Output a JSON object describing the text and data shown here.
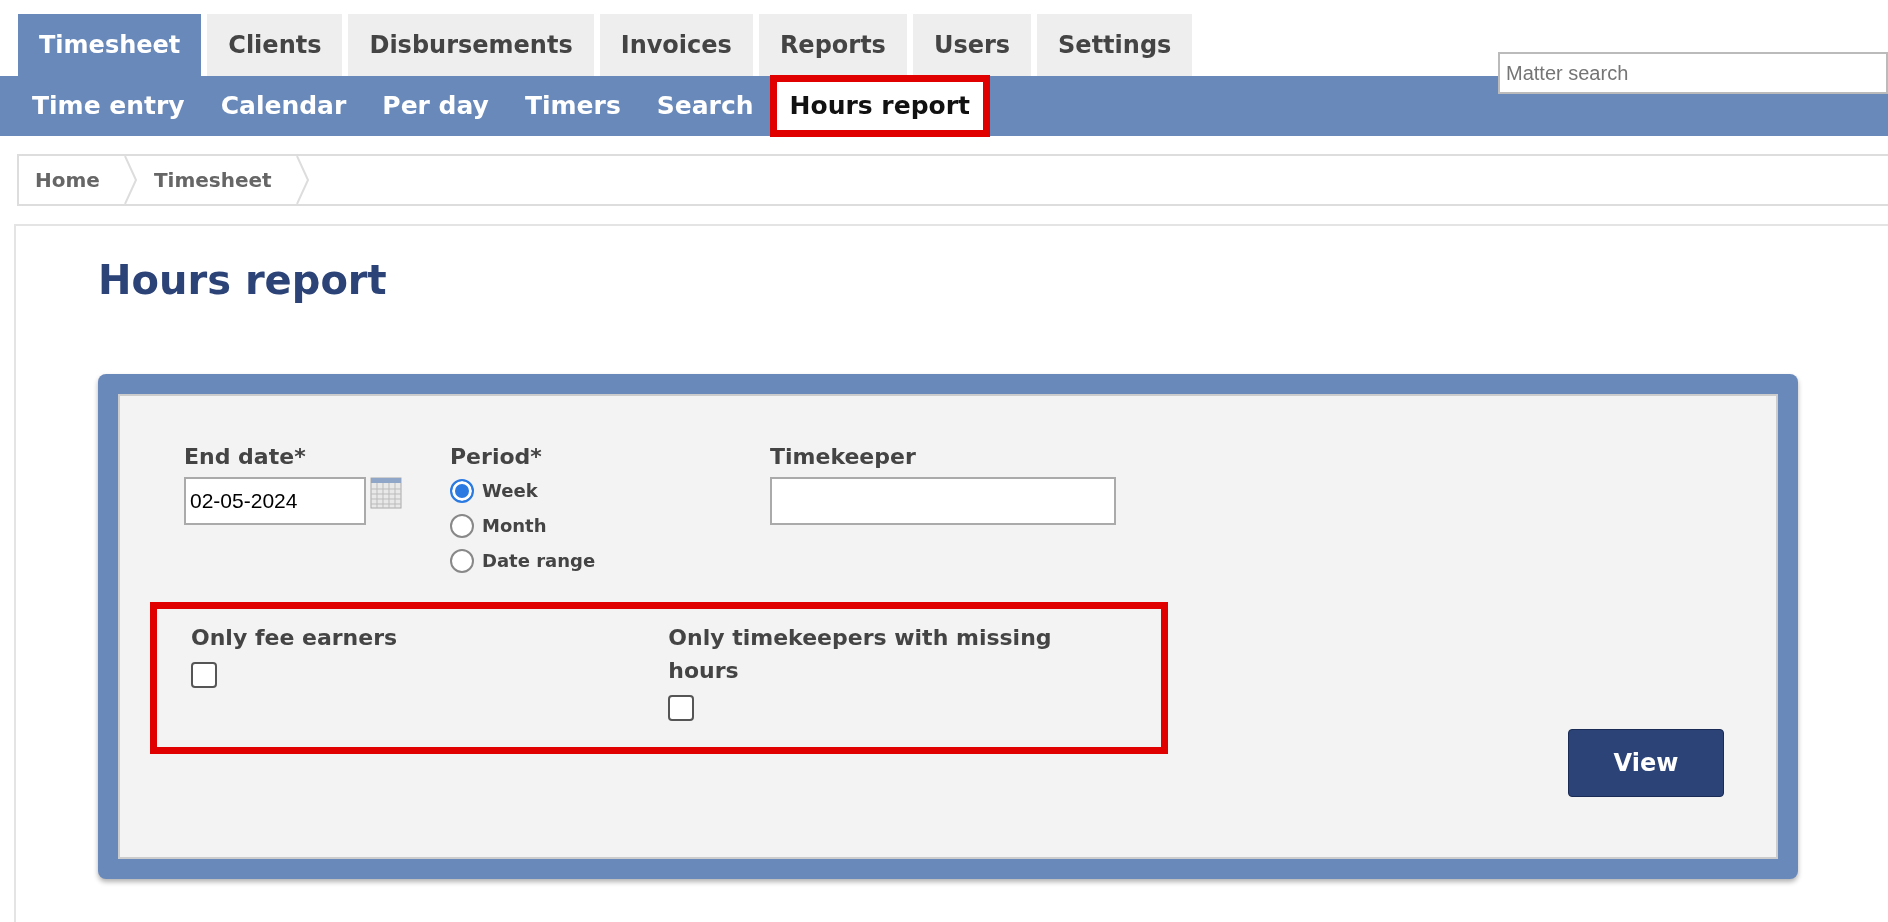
{
  "tabs": [
    {
      "label": "Timesheet",
      "selected": true
    },
    {
      "label": "Clients",
      "selected": false
    },
    {
      "label": "Disbursements",
      "selected": false
    },
    {
      "label": "Invoices",
      "selected": false
    },
    {
      "label": "Reports",
      "selected": false
    },
    {
      "label": "Users",
      "selected": false
    },
    {
      "label": "Settings",
      "selected": false
    }
  ],
  "search": {
    "placeholder": "Matter search"
  },
  "subtabs": [
    {
      "label": "Time entry",
      "selected": false,
      "highlighted": false
    },
    {
      "label": "Calendar",
      "selected": false,
      "highlighted": false
    },
    {
      "label": "Per day",
      "selected": false,
      "highlighted": false
    },
    {
      "label": "Timers",
      "selected": false,
      "highlighted": false
    },
    {
      "label": "Search",
      "selected": false,
      "highlighted": false
    },
    {
      "label": "Hours report",
      "selected": true,
      "highlighted": true
    }
  ],
  "breadcrumb": [
    "Home",
    "Timesheet"
  ],
  "title": "Hours report",
  "form": {
    "end_date": {
      "label": "End date*",
      "value": "02-05-2024"
    },
    "period": {
      "label": "Period*",
      "options": [
        {
          "label": "Week",
          "selected": true
        },
        {
          "label": "Month",
          "selected": false
        },
        {
          "label": "Date range",
          "selected": false
        }
      ]
    },
    "timekeeper": {
      "label": "Timekeeper"
    },
    "filters_highlighted": true,
    "filters": [
      {
        "label": "Only fee earners",
        "checked": false
      },
      {
        "label": "Only timekeepers with missing hours",
        "checked": false
      }
    ],
    "button": "View"
  }
}
